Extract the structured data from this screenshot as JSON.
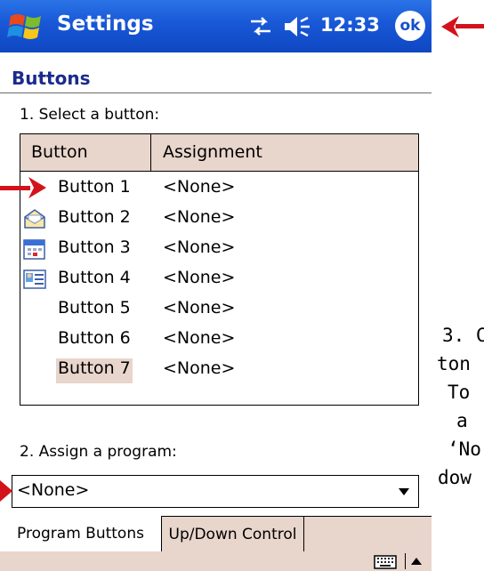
{
  "title_bar": {
    "title": "Settings",
    "clock": "12:33",
    "ok_label": "ok",
    "brand_color": "#1857d6"
  },
  "page": {
    "heading": "Buttons"
  },
  "step1": {
    "label": "1. Select a button:"
  },
  "table": {
    "columns": [
      "Button",
      "Assignment"
    ],
    "rows": [
      {
        "button": "Button 1",
        "assignment": "<None>",
        "icon": "none"
      },
      {
        "button": "Button 2",
        "assignment": "<None>",
        "icon": "envelope-icon"
      },
      {
        "button": "Button 3",
        "assignment": "<None>",
        "icon": "calendar-icon"
      },
      {
        "button": "Button 4",
        "assignment": "<None>",
        "icon": "contact-card-icon"
      },
      {
        "button": "Button 5",
        "assignment": "<None>",
        "icon": "none"
      },
      {
        "button": "Button 6",
        "assignment": "<None>",
        "icon": "none"
      },
      {
        "button": "Button 7",
        "assignment": "<None>",
        "icon": "none",
        "selected": true
      }
    ]
  },
  "step2": {
    "label": "2. Assign a program:",
    "dropdown_value": "<None>"
  },
  "tabs": [
    {
      "label": "Program Buttons",
      "active": true
    },
    {
      "label": "Up/Down Control",
      "active": false
    }
  ],
  "side_text": {
    "line1": "3. C",
    "line2": "ton",
    "line3": "To",
    "line4": "a",
    "line5": "‘No",
    "line6": "dow"
  },
  "colors": {
    "accent_tan": "#e8d5cb",
    "annotation_red": "#d3121b",
    "heading_blue": "#1b2a8c"
  }
}
